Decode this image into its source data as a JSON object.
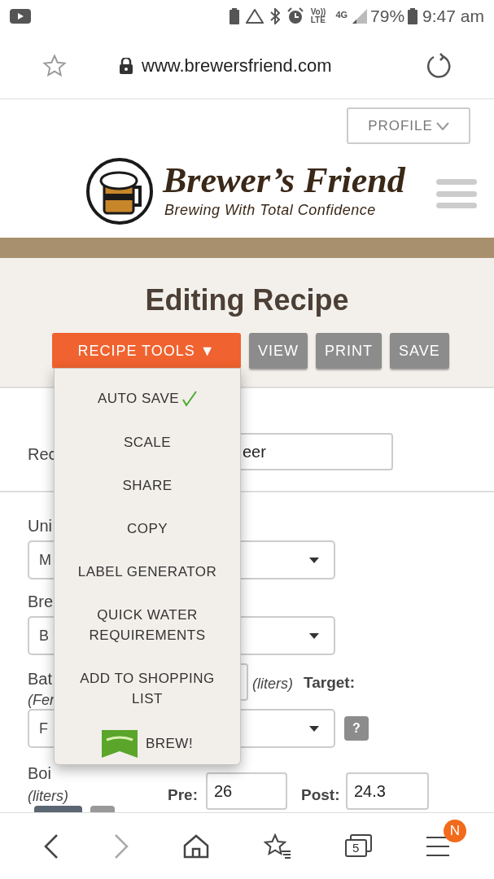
{
  "status_bar": {
    "volte_top": "Vo))",
    "volte_bottom": "LTE",
    "network": "4G",
    "battery": "79%",
    "time": "9:47 am"
  },
  "browser": {
    "url": "www.brewersfriend.com",
    "tab_count": "5",
    "menu_badge": "N"
  },
  "header": {
    "profile_button": "PROFILE",
    "logo_title": "Brewer’s Friend",
    "logo_tagline": "Brewing With Total Confidence"
  },
  "page_title": "Editing Recipe",
  "toolbar": {
    "tools_button": {
      "label": "RECIPE TOOLS",
      "caret": "▼",
      "expanded": true
    },
    "buttons": [
      "VIEW",
      "PRINT",
      "SAVE"
    ]
  },
  "dropdown": [
    {
      "kind": "toggle",
      "label": "AUTO SAVE",
      "checked": true
    },
    {
      "kind": "action",
      "label": "SCALE"
    },
    {
      "kind": "action",
      "label": "SHARE"
    },
    {
      "kind": "action",
      "label": "COPY"
    },
    {
      "kind": "action",
      "label": "LABEL GENERATOR"
    },
    {
      "kind": "action",
      "label": "QUICK WATER REQUIREMENTS"
    },
    {
      "kind": "action",
      "label": "ADD TO SHOPPING LIST"
    },
    {
      "kind": "brew",
      "label": "BREW!"
    }
  ],
  "form": {
    "recipe_name": {
      "label": "Rec",
      "value": "eer"
    },
    "units": {
      "label": "Uni",
      "value": "M"
    },
    "brew_method": {
      "label": "Bre",
      "value": "B"
    },
    "batch_size": {
      "label": "Bat",
      "sublabel": "(Fer",
      "unit": "(liters)",
      "target_label": "Target:",
      "target_value": "F",
      "help": "?"
    },
    "boil_size": {
      "label": "Boi",
      "unit": "(liters)",
      "pre_label": "Pre:",
      "pre_value": "26",
      "post_label": "Post:",
      "post_value": "24.3"
    }
  }
}
